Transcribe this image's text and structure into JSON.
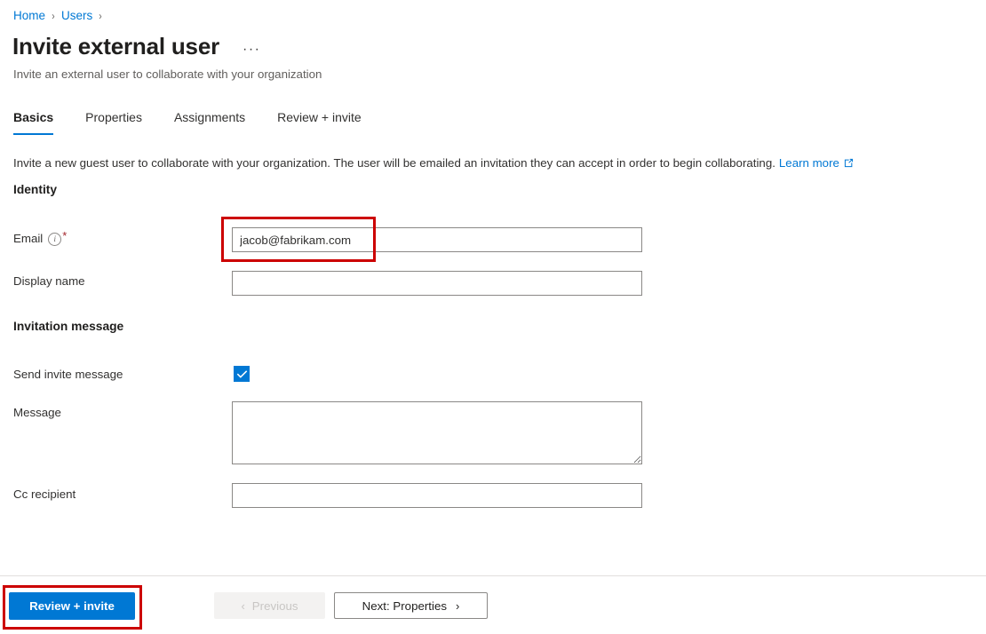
{
  "breadcrumb": {
    "items": [
      {
        "label": "Home"
      },
      {
        "label": "Users"
      }
    ],
    "separator": "›"
  },
  "header": {
    "title": "Invite external user",
    "subtitle": "Invite an external user to collaborate with your organization",
    "more_menu": "···"
  },
  "tabs": [
    {
      "label": "Basics",
      "active": true
    },
    {
      "label": "Properties",
      "active": false
    },
    {
      "label": "Assignments",
      "active": false
    },
    {
      "label": "Review + invite",
      "active": false
    }
  ],
  "description": {
    "text": "Invite a new guest user to collaborate with your organization. The user will be emailed an invitation they can accept in order to begin collaborating.",
    "link_label": "Learn more",
    "link_icon": "external-link-icon"
  },
  "sections": {
    "identity": {
      "heading": "Identity",
      "fields": {
        "email": {
          "label": "Email",
          "info_icon": "info-icon",
          "required_marker": "*",
          "value": "jacob@fabrikam.com",
          "placeholder": ""
        },
        "display_name": {
          "label": "Display name",
          "value": "",
          "placeholder": ""
        }
      }
    },
    "invitation_message": {
      "heading": "Invitation message",
      "fields": {
        "send_invite_message": {
          "label": "Send invite message",
          "checked": true,
          "check_glyph": "✓"
        },
        "message": {
          "label": "Message",
          "value": "",
          "placeholder": ""
        },
        "cc_recipient": {
          "label": "Cc recipient",
          "value": "",
          "placeholder": ""
        }
      }
    }
  },
  "footer": {
    "review_invite": "Review + invite",
    "previous": "Previous",
    "previous_chevron": "‹",
    "next": "Next: Properties",
    "next_chevron": "›"
  },
  "colors": {
    "accent": "#0078d4",
    "link": "#0078d4",
    "required": "#a4262c",
    "annotation": "#cc0000",
    "border": "#8a8886",
    "divider": "#e1dfdd",
    "disabled_bg": "#f3f2f1",
    "disabled_text": "#c8c6c4"
  }
}
